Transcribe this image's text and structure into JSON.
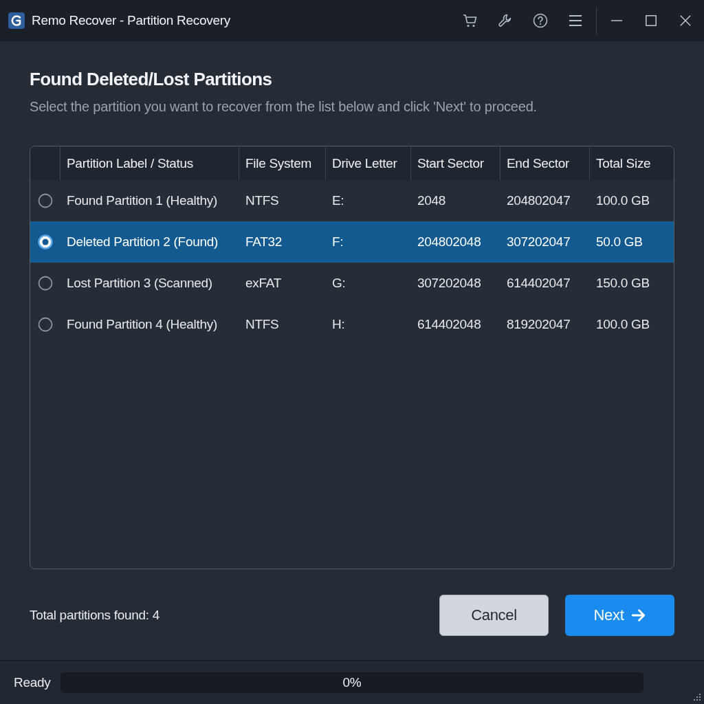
{
  "window": {
    "title": "Remo Recover - Partition Recovery"
  },
  "heading": "Found Deleted/Lost Partitions",
  "subtitle": "Select the partition you want to recover from the list below and click 'Next' to proceed.",
  "table": {
    "columns": [
      "Partition Label / Status",
      "File System",
      "Drive Letter",
      "Start Sector",
      "End Sector",
      "Total Size"
    ],
    "rows": [
      {
        "selected": false,
        "cells": [
          "Found Partition 1 (Healthy)",
          "NTFS",
          "E:",
          "2048",
          "204802047",
          "100.0 GB"
        ]
      },
      {
        "selected": true,
        "cells": [
          "Deleted Partition 2 (Found)",
          "FAT32",
          "F:",
          "204802048",
          "307202047",
          "50.0 GB"
        ]
      },
      {
        "selected": false,
        "cells": [
          "Lost Partition 3 (Scanned)",
          "exFAT",
          "G:",
          "307202048",
          "614402047",
          "150.0 GB"
        ]
      },
      {
        "selected": false,
        "cells": [
          "Found Partition 4 (Healthy)",
          "NTFS",
          "H:",
          "614402048",
          "819202047",
          "100.0 GB"
        ]
      }
    ]
  },
  "summary": "Total partitions found: 4",
  "buttons": [
    {
      "label": "Cancel",
      "kind": "secondary"
    },
    {
      "label": "Next",
      "kind": "primary"
    }
  ],
  "status_bar": {
    "status": "Ready",
    "progress": {
      "level": 0,
      "reading": "0%"
    }
  }
}
